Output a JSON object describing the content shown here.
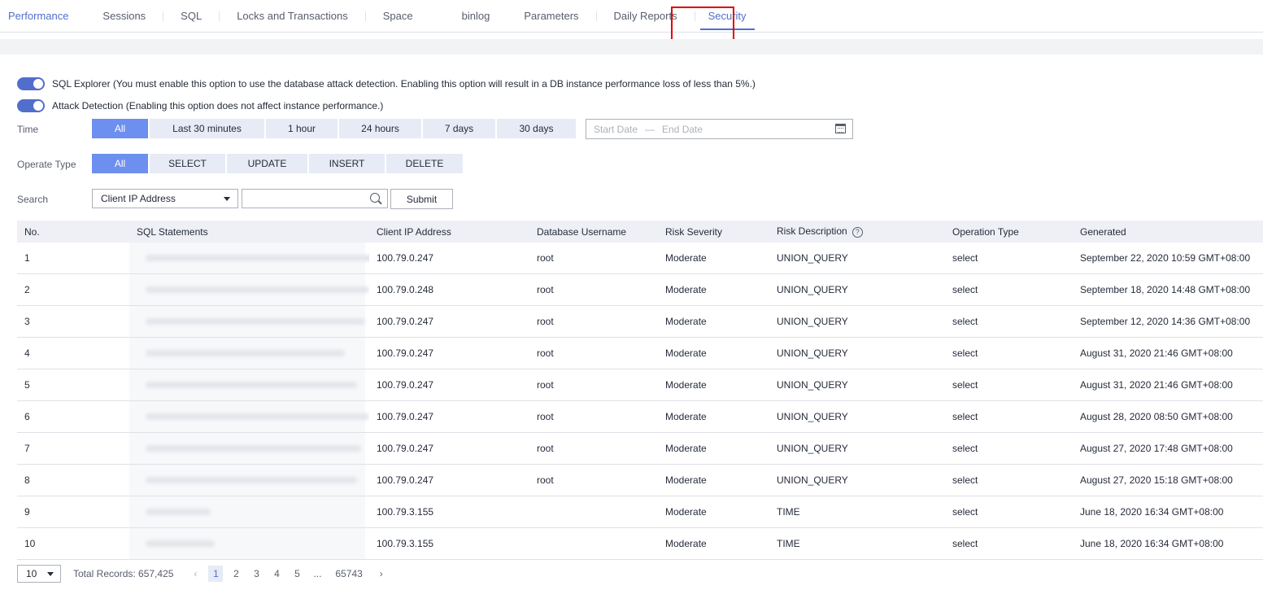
{
  "tabs": [
    {
      "label": "Performance"
    },
    {
      "label": "Sessions"
    },
    {
      "label": "SQL"
    },
    {
      "label": "Locks and Transactions"
    },
    {
      "label": "Space"
    },
    {
      "label": "binlog"
    },
    {
      "label": "Parameters"
    },
    {
      "label": "Daily Reports"
    },
    {
      "label": "Security",
      "active": true
    }
  ],
  "toggles": {
    "sql_explorer": {
      "label": "SQL Explorer (You must enable this option to use the database attack detection. Enabling this option will result in a DB instance performance loss of less than 5%.)",
      "enabled": true
    },
    "attack_detection": {
      "label": "Attack Detection (Enabling this option does not affect instance performance.)",
      "enabled": true
    }
  },
  "filters": {
    "time_label": "Time",
    "time_options": [
      "All",
      "Last 30 minutes",
      "1 hour",
      "24 hours",
      "7 days",
      "30 days"
    ],
    "time_selected": "All",
    "date_start_placeholder": "Start Date",
    "date_dash": "—",
    "date_end_placeholder": "End Date",
    "operate_label": "Operate Type",
    "operate_options": [
      "All",
      "SELECT",
      "UPDATE",
      "INSERT",
      "DELETE"
    ],
    "operate_selected": "All",
    "search_label": "Search",
    "search_field": "Client IP Address",
    "search_value": "",
    "submit_label": "Submit"
  },
  "table": {
    "headers": [
      "No.",
      "SQL Statements",
      "Client IP Address",
      "Database Username",
      "Risk Severity",
      "Risk Description",
      "Operation Type",
      "Generated"
    ],
    "rows": [
      {
        "no": "1",
        "ip": "100.79.0.247",
        "user": "root",
        "severity": "Moderate",
        "desc": "UNION_QUERY",
        "op": "select",
        "generated": "September 22, 2020 10:59 GMT+08:00"
      },
      {
        "no": "2",
        "ip": "100.79.0.248",
        "user": "root",
        "severity": "Moderate",
        "desc": "UNION_QUERY",
        "op": "select",
        "generated": "September 18, 2020 14:48 GMT+08:00"
      },
      {
        "no": "3",
        "ip": "100.79.0.247",
        "user": "root",
        "severity": "Moderate",
        "desc": "UNION_QUERY",
        "op": "select",
        "generated": "September 12, 2020 14:36 GMT+08:00"
      },
      {
        "no": "4",
        "ip": "100.79.0.247",
        "user": "root",
        "severity": "Moderate",
        "desc": "UNION_QUERY",
        "op": "select",
        "generated": "August 31, 2020 21:46 GMT+08:00"
      },
      {
        "no": "5",
        "ip": "100.79.0.247",
        "user": "root",
        "severity": "Moderate",
        "desc": "UNION_QUERY",
        "op": "select",
        "generated": "August 31, 2020 21:46 GMT+08:00"
      },
      {
        "no": "6",
        "ip": "100.79.0.247",
        "user": "root",
        "severity": "Moderate",
        "desc": "UNION_QUERY",
        "op": "select",
        "generated": "August 28, 2020 08:50 GMT+08:00"
      },
      {
        "no": "7",
        "ip": "100.79.0.247",
        "user": "root",
        "severity": "Moderate",
        "desc": "UNION_QUERY",
        "op": "select",
        "generated": "August 27, 2020 17:48 GMT+08:00"
      },
      {
        "no": "8",
        "ip": "100.79.0.247",
        "user": "root",
        "severity": "Moderate",
        "desc": "UNION_QUERY",
        "op": "select",
        "generated": "August 27, 2020 15:18 GMT+08:00"
      },
      {
        "no": "9",
        "ip": "100.79.3.155",
        "user": "",
        "severity": "Moderate",
        "desc": "TIME",
        "op": "select",
        "generated": "June 18, 2020 16:34 GMT+08:00"
      },
      {
        "no": "10",
        "ip": "100.79.3.155",
        "user": "",
        "severity": "Moderate",
        "desc": "TIME",
        "op": "select",
        "generated": "June 18, 2020 16:34 GMT+08:00"
      }
    ]
  },
  "pagination": {
    "page_size": "10",
    "total": "Total Records: 657,425",
    "pages": [
      "1",
      "2",
      "3",
      "4",
      "5",
      "...",
      "65743"
    ],
    "current": "1"
  },
  "colors": {
    "accent": "#526ecc",
    "highlight": "#e00000"
  }
}
